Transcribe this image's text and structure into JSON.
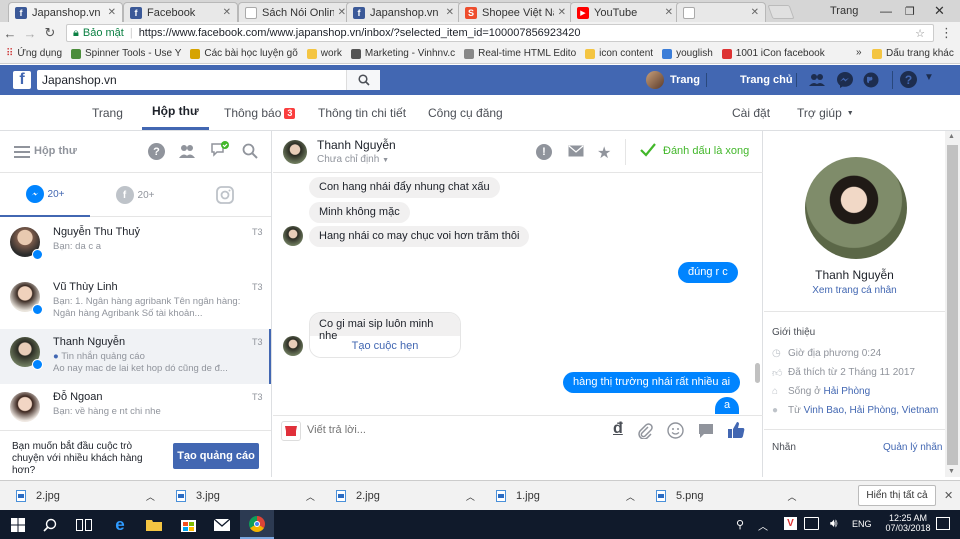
{
  "browser": {
    "tabs": [
      {
        "label": "Japanshop.vn",
        "active": true,
        "fav_color": "#3b5998",
        "fav_glyph": "f"
      },
      {
        "label": "Facebook",
        "active": false,
        "fav_color": "#3b5998",
        "fav_glyph": "f"
      },
      {
        "label": "Sách Nói Online -",
        "active": false,
        "fav_color": "#cfcfcf",
        "fav_glyph": ""
      },
      {
        "label": "Japanshop.vn",
        "active": false,
        "fav_color": "#3b5998",
        "fav_glyph": "f"
      },
      {
        "label": "Shopee Việt Nam",
        "active": false,
        "fav_color": "#ee4d2d",
        "fav_glyph": "S"
      },
      {
        "label": "YouTube",
        "active": false,
        "fav_color": "#ff0000",
        "fav_glyph": "▶"
      },
      {
        "label": "",
        "active": false,
        "fav_color": "#cfcfcf",
        "fav_glyph": ""
      }
    ],
    "user_label": "Trang",
    "secure_label": "Bảo mật",
    "url": "https://www.facebook.com/www.japanshop.vn/inbox/?selected_item_id=100007856923420",
    "bookmarks": [
      {
        "label": "Ứng dụng",
        "color": "#e04a3f"
      },
      {
        "label": "Spinner Tools - Use Y",
        "color": "#4a8c3a"
      },
      {
        "label": "Các bài học luyện gõ",
        "color": "#d6a300"
      },
      {
        "label": "work",
        "color": "#f4c542"
      },
      {
        "label": "Marketing - Vinhnv.c",
        "color": "#555555"
      },
      {
        "label": "Real-time HTML Edito",
        "color": "#888888"
      },
      {
        "label": "icon content",
        "color": "#f4c542"
      },
      {
        "label": "youglish",
        "color": "#3b7dd8"
      },
      {
        "label": "1001 iCon facebook",
        "color": "#d33"
      }
    ],
    "bookmarks_more": "»",
    "bookmarks_other": "Dấu trang khác"
  },
  "fb": {
    "search_value": "Japanshop.vn",
    "user_name": "Trang",
    "home_label": "Trang chủ"
  },
  "page_nav": {
    "items": [
      "Trang",
      "Hộp thư",
      "Thông báo",
      "Thông tin chi tiết",
      "Công cụ đăng"
    ],
    "notif_count": "3",
    "settings": "Cài đặt",
    "help": "Trợ giúp"
  },
  "inbox": {
    "title": "Hộp thư",
    "tabs": [
      {
        "label": "20+",
        "color": "#0084ff"
      },
      {
        "label": "20+",
        "color": "#90949c"
      },
      {
        "label": "",
        "color": "#90949c"
      }
    ],
    "conversations": [
      {
        "name": "Nguyễn Thu Thuỷ",
        "preview": "Bạn: da c a",
        "time": "T3",
        "avatar_color": "#7a5a4a"
      },
      {
        "name": "Vũ Thùy Linh",
        "preview": "Bạn: 1. Ngân hàng agribank Tên ngân hàng: Ngân hàng Agribank Số tài khoản...",
        "time": "T3",
        "avatar_color": "#6b4a3a"
      },
      {
        "name": "Thanh Nguyễn",
        "preview_tag": "Tin nhắn quảng cáo",
        "preview": "Ao nay mac de lai ket hop dó cũng de đ...",
        "time": "T3",
        "avatar_color": "#3a4a3a"
      },
      {
        "name": "Đỗ Ngoan",
        "preview": "Bạn: về hàng e nt chi nhe",
        "time": "T3",
        "avatar_color": "#8a5a4a"
      }
    ],
    "ad_text": "Bạn muốn bắt đầu cuộc trò chuyện với nhiều khách hàng hơn?",
    "ad_button": "Tạo quảng cáo"
  },
  "chat": {
    "contact": "Thanh Nguyễn",
    "assign": "Chưa chỉ định",
    "mark_done": "Đánh dấu là xong",
    "messages": [
      {
        "from": "them",
        "text": "Con hang nhái  đẩy  nhung chat xấu"
      },
      {
        "from": "them",
        "text": "Minh không mặc"
      },
      {
        "from": "them",
        "text": "Hang nhái  co may chục  voi hơn  trăm  thôi"
      },
      {
        "from": "me",
        "text": "đúng r c"
      },
      {
        "from": "them",
        "text": "Co gi mai sip luôn minh nhe"
      },
      {
        "from": "them_action",
        "text": "Tạo cuộc hẹn"
      },
      {
        "from": "me",
        "text": "hàng thị trường nhái rất nhiều ai"
      },
      {
        "from": "me",
        "text": "a"
      }
    ],
    "reply_placeholder": "Viết trả lời...",
    "currency_glyph": "đ"
  },
  "profile": {
    "name": "Thanh Nguyễn",
    "view_profile": "Xem trang cá nhân",
    "intro_title": "Giới thiệu",
    "local_time": "Giờ địa phương 0:24",
    "liked": "Đã thích từ 2 Tháng 11 2017",
    "lives_prefix": "Sống ở ",
    "lives_place": "Hải Phòng",
    "from_prefix": "Từ ",
    "from_place": "Vinh Bao, Hải Phòng, Vietnam",
    "labels_title": "Nhãn",
    "manage_labels": "Quản lý nhãn"
  },
  "downloads": {
    "items": [
      "2.jpg",
      "3.jpg",
      "2.jpg",
      "1.jpg",
      "5.png"
    ],
    "show_all": "Hiển thị tất cả"
  },
  "taskbar": {
    "time": "12:25 AM",
    "date": "07/03/2018",
    "lang": "ENG"
  }
}
